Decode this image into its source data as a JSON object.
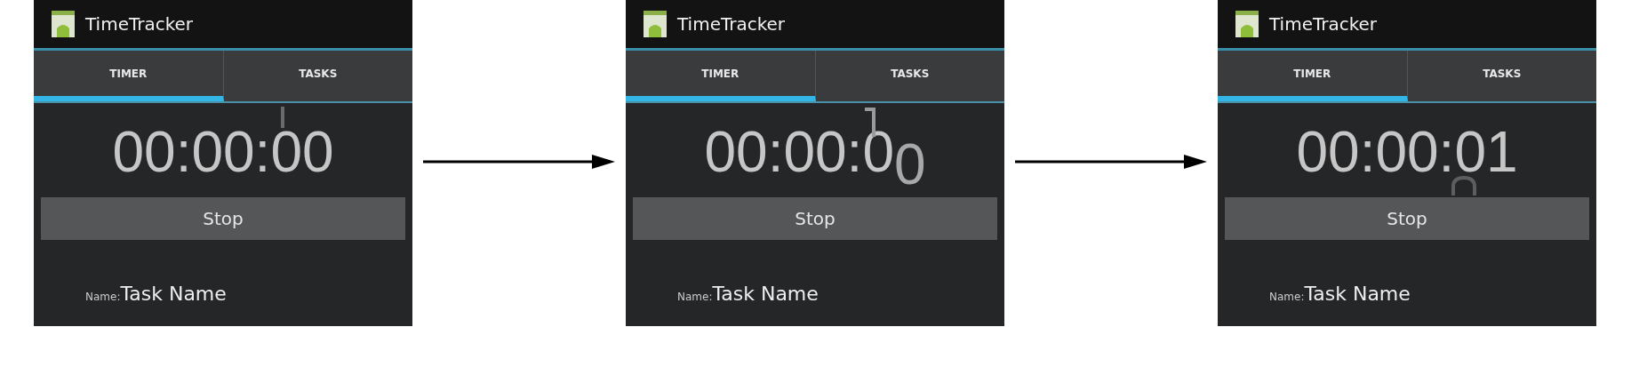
{
  "panels": [
    {
      "app_title": "TimeTracker",
      "tabs": [
        {
          "label": "TIMER",
          "selected": true
        },
        {
          "label": "TASKS",
          "selected": false
        }
      ],
      "timer": {
        "prefix": "00:00:0",
        "digit": "0",
        "kind": "start"
      },
      "button": "Stop",
      "name_label": "Name:",
      "name_value": "Task Name"
    },
    {
      "app_title": "TimeTracker",
      "tabs": [
        {
          "label": "TIMER",
          "selected": true
        },
        {
          "label": "TASKS",
          "selected": false
        }
      ],
      "timer": {
        "prefix": "00:00:0",
        "digit": "0",
        "kind": "mid"
      },
      "button": "Stop",
      "name_label": "Name:",
      "name_value": "Task Name"
    },
    {
      "app_title": "TimeTracker",
      "tabs": [
        {
          "label": "TIMER",
          "selected": true
        },
        {
          "label": "TASKS",
          "selected": false
        }
      ],
      "timer": {
        "prefix": "00:00:0",
        "digit": "1",
        "kind": "end"
      },
      "button": "Stop",
      "name_label": "Name:",
      "name_value": "Task Name"
    }
  ]
}
